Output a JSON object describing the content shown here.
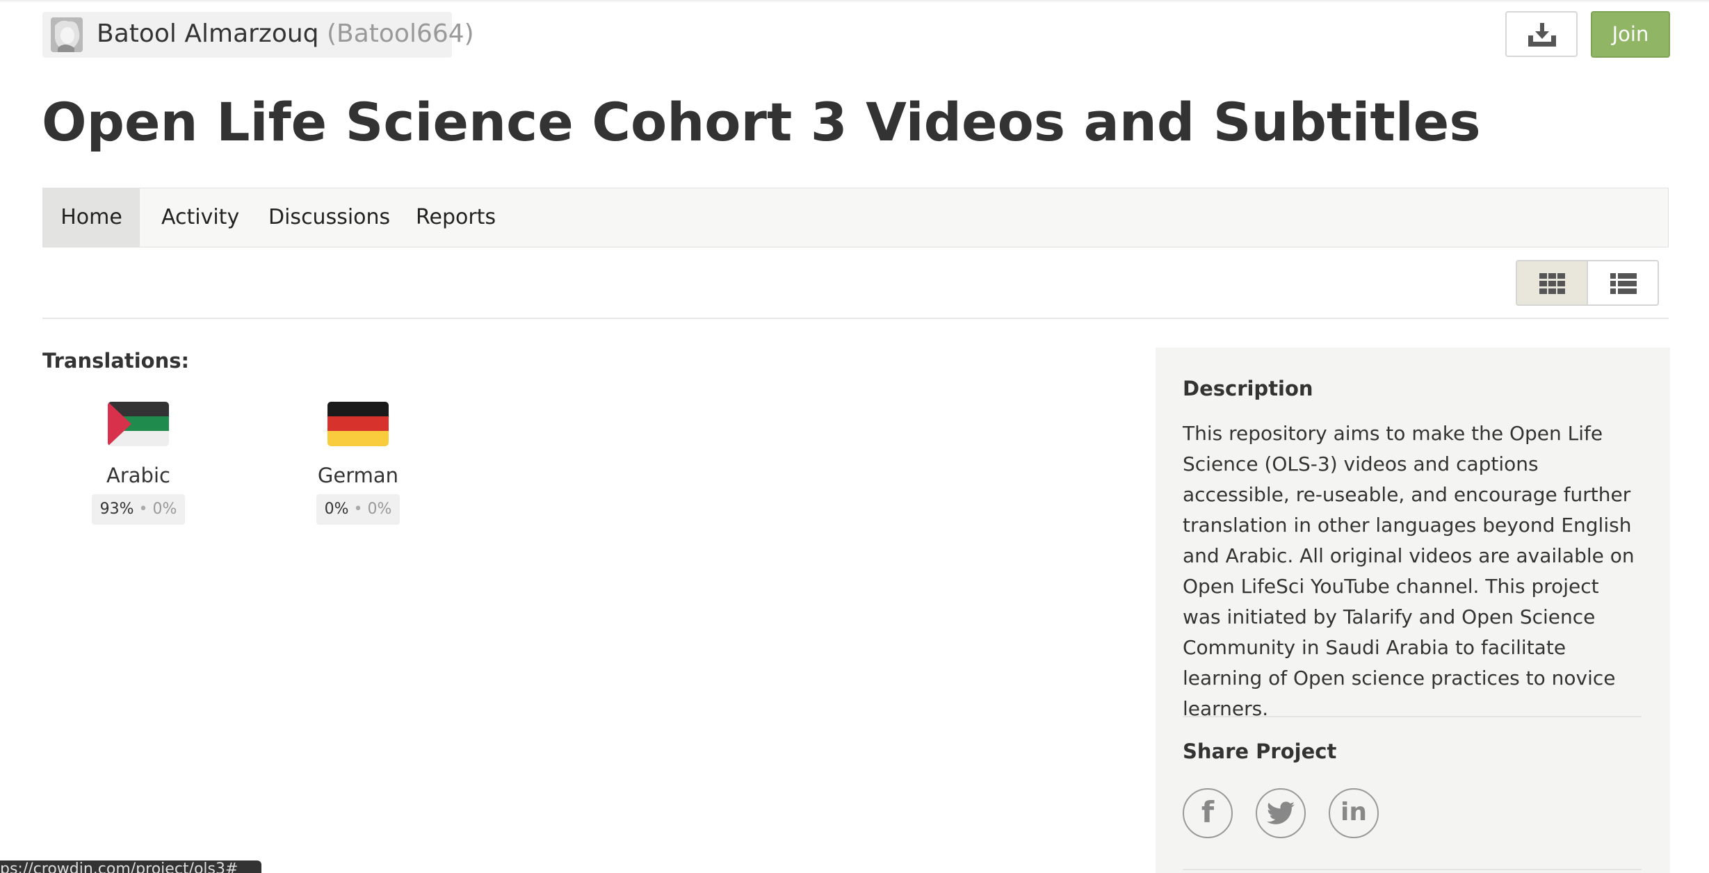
{
  "header": {
    "owner_name": "Batool Almarzouq",
    "owner_username": "(Batool664)",
    "join_label": "Join"
  },
  "project": {
    "title": "Open Life Science Cohort 3 Videos and Subtitles"
  },
  "tabs": [
    {
      "label": "Home",
      "active": true
    },
    {
      "label": "Activity",
      "active": false
    },
    {
      "label": "Discussions",
      "active": false
    },
    {
      "label": "Reports",
      "active": false
    }
  ],
  "view_toggle": {
    "selected": "grid"
  },
  "translations": {
    "heading": "Translations:",
    "languages": [
      {
        "name": "Arabic",
        "translated": "93%",
        "approved": "0%",
        "separator": "•"
      },
      {
        "name": "German",
        "translated": "0%",
        "approved": "0%",
        "separator": "•"
      }
    ]
  },
  "sidebar": {
    "description_title": "Description",
    "description_text": "This repository aims to make the Open Life Science (OLS-3) videos and captions accessible, re-useable, and encourage further translation in other languages beyond English and Arabic. All original videos are available on Open LifeSci YouTube channel. This project was initiated by Talarify and Open Science Community in Saudi Arabia to facilitate learning of Open science practices to novice learners.",
    "share_title": "Share Project",
    "share_facebook": "f",
    "share_linkedin": "in"
  },
  "status_bar": {
    "url": "ps://crowdin.com/project/ols3#"
  },
  "colors": {
    "join_button": "#8fb565",
    "tabs_background": "#f7f7f5",
    "sidebar_background": "#f4f4f2"
  },
  "icons": {
    "download": "download-icon",
    "grid_view": "grid-view-icon",
    "list_view": "list-view-icon",
    "twitter": "twitter-icon"
  }
}
